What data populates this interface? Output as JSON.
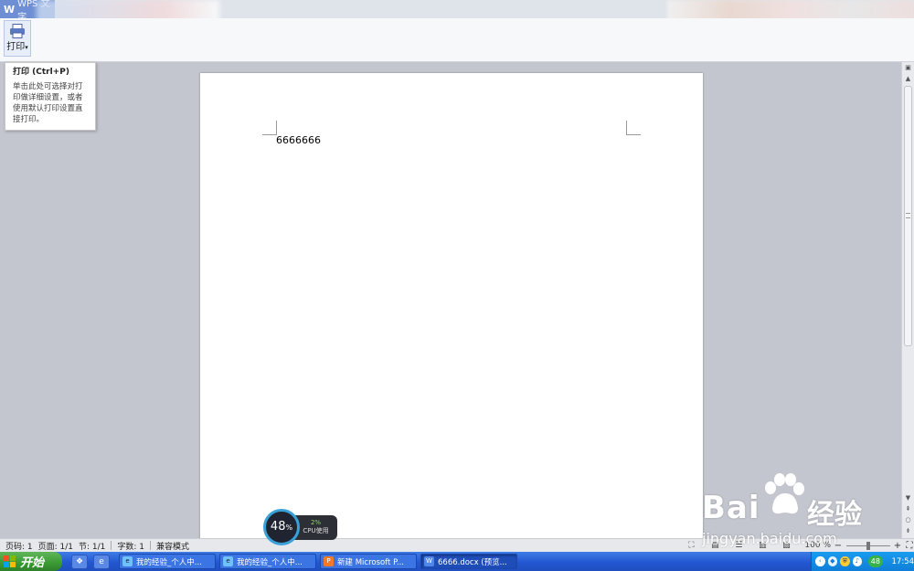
{
  "window": {
    "app_title": "WPS 文字",
    "logo": "W"
  },
  "ribbon": {
    "print_label": "打印"
  },
  "tooltip": {
    "title": "打印 (Ctrl+P)",
    "body": "单击此处可选择对打印做详细设置，或者使用默认打印设置直接打印。"
  },
  "document": {
    "text": "6666666"
  },
  "statusbar": {
    "page_no": "页码: 1",
    "pages": "页面: 1/1",
    "section": "节: 1/1",
    "word_count": "字数: 1",
    "mode": "兼容模式",
    "zoom": "100 %"
  },
  "cpu_widget": {
    "percent": "48",
    "percent_unit": "%",
    "usage_value": "2%",
    "usage_label": "CPU使用"
  },
  "watermark": {
    "brand": "Bai",
    "brand_cn": "经验",
    "url": "jingyan.baidu.com"
  },
  "taskbar": {
    "start_label": "开始",
    "tasks": [
      {
        "label": "我的经验_个人中...",
        "icon": "ie-icon"
      },
      {
        "label": "我的经验_个人中...",
        "icon": "ie-icon"
      },
      {
        "label": "新建 Microsoft P...",
        "icon": "powerpoint-icon"
      },
      {
        "label": "6666.docx (预览...",
        "icon": "wps-writer-icon"
      }
    ],
    "tray_badge": "48",
    "clock": "17:54"
  },
  "colors": {
    "taskbar": "#2357d1",
    "start": "#3a9a33",
    "accent": "#3aa0d8"
  }
}
